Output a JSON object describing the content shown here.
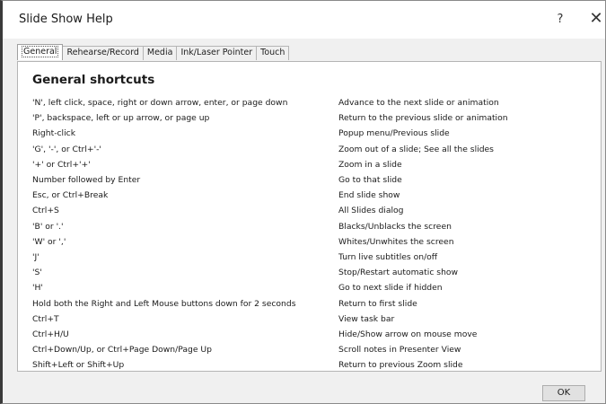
{
  "window": {
    "title": "Slide Show Help",
    "help_glyph": "?",
    "close_glyph": "✕"
  },
  "tabs": [
    {
      "label": "General",
      "active": true
    },
    {
      "label": "Rehearse/Record",
      "active": false
    },
    {
      "label": "Media",
      "active": false
    },
    {
      "label": "Ink/Laser Pointer",
      "active": false
    },
    {
      "label": "Touch",
      "active": false
    }
  ],
  "panel": {
    "heading": "General shortcuts",
    "shortcuts": [
      {
        "key": "'N', left click, space, right or down arrow, enter, or page down",
        "action": "Advance to the next slide or animation"
      },
      {
        "key": "'P', backspace, left or up arrow, or page up",
        "action": "Return to the previous slide or animation"
      },
      {
        "key": "Right-click",
        "action": "Popup menu/Previous slide"
      },
      {
        "key": "'G', '-', or Ctrl+'-'",
        "action": "Zoom out of a slide; See all the slides"
      },
      {
        "key": "'+' or Ctrl+'+'",
        "action": "Zoom in a slide"
      },
      {
        "key": "Number followed by Enter",
        "action": "Go to that slide"
      },
      {
        "key": "Esc, or Ctrl+Break",
        "action": "End slide show"
      },
      {
        "key": "Ctrl+S",
        "action": "All Slides dialog"
      },
      {
        "key": "'B' or '.'",
        "action": "Blacks/Unblacks the screen"
      },
      {
        "key": "'W' or ','",
        "action": "Whites/Unwhites the screen"
      },
      {
        "key": "'J'",
        "action": "Turn live subtitles on/off"
      },
      {
        "key": "'S'",
        "action": "Stop/Restart automatic show"
      },
      {
        "key": "'H'",
        "action": "Go to next slide if hidden"
      },
      {
        "key": "Hold both the Right and Left Mouse buttons down for 2 seconds",
        "action": "Return to first slide"
      },
      {
        "key": "Ctrl+T",
        "action": "View task bar"
      },
      {
        "key": "Ctrl+H/U",
        "action": "Hide/Show arrow on mouse move"
      },
      {
        "key": "Ctrl+Down/Up, or Ctrl+Page Down/Page Up",
        "action": "Scroll notes in Presenter View"
      },
      {
        "key": "Shift+Left or Shift+Up",
        "action": "Return to previous Zoom slide"
      }
    ]
  },
  "footer": {
    "ok_label": "OK"
  }
}
